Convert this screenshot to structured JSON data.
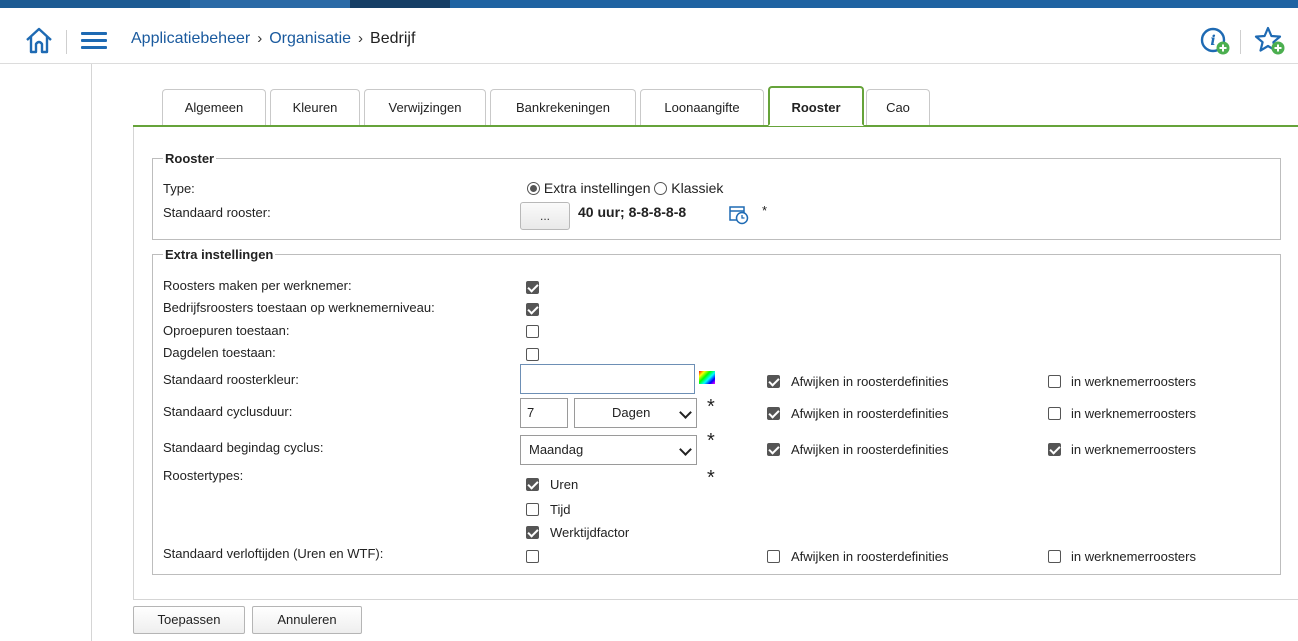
{
  "header": {
    "breadcrumb": [
      "Applicatiebeheer",
      "Organisatie",
      "Bedrijf"
    ],
    "separator": "›"
  },
  "tabs": [
    {
      "label": "Algemeen",
      "active": false
    },
    {
      "label": "Kleuren",
      "active": false
    },
    {
      "label": "Verwijzingen",
      "active": false
    },
    {
      "label": "Bankrekeningen",
      "active": false
    },
    {
      "label": "Loonaangifte",
      "active": false
    },
    {
      "label": "Rooster",
      "active": true
    },
    {
      "label": "Cao",
      "active": false
    }
  ],
  "rooster": {
    "legend": "Rooster",
    "type_label": "Type:",
    "type_options": [
      "Extra instellingen",
      "Klassiek"
    ],
    "type_selected": "Extra instellingen",
    "standaard_label": "Standaard rooster:",
    "picker_label": "...",
    "standaard_value": "40 uur; 8-8-8-8-8",
    "required_marker": "*"
  },
  "extra": {
    "legend": "Extra instellingen",
    "per_werknemer_label": "Roosters maken per werknemer:",
    "per_werknemer": true,
    "bedrijfsroosters_label": "Bedrijfsroosters toestaan op werknemerniveau:",
    "bedrijfsroosters": true,
    "oproepuren_label": "Oproepuren toestaan:",
    "oproepuren": false,
    "dagdelen_label": "Dagdelen toestaan:",
    "dagdelen": false,
    "kleur_label": "Standaard roosterkleur:",
    "kleur_value": "",
    "cyclusduur_label": "Standaard cyclusduur:",
    "cyclusduur_value": "7",
    "cyclusduur_unit": "Dagen",
    "begindag_label": "Standaard begindag cyclus:",
    "begindag_value": "Maandag",
    "roostertypes_label": "Roostertypes:",
    "roostertypes": [
      {
        "label": "Uren",
        "checked": true
      },
      {
        "label": "Tijd",
        "checked": false
      },
      {
        "label": "Werktijdfactor",
        "checked": true
      }
    ],
    "verloftijden_label": "Standaard verloftijden (Uren en WTF):",
    "verloftijden": false,
    "star": "*",
    "afwijken_label": "Afwijken in roosterdefinities",
    "werknemer_label": "in werknemerroosters",
    "overrides": [
      {
        "row": "kleur",
        "afwijken": true,
        "werknemer": false
      },
      {
        "row": "cyclusduur",
        "afwijken": true,
        "werknemer": false
      },
      {
        "row": "begindag",
        "afwijken": true,
        "werknemer": true
      },
      {
        "row": "verloftijden",
        "afwijken": false,
        "werknemer": false
      }
    ]
  },
  "buttons": {
    "apply": "Toepassen",
    "cancel": "Annuleren"
  },
  "colors": {
    "brand_blue": "#1d5b93",
    "link_blue": "#1a5a9e",
    "active_tab_green": "#66a33a",
    "badge_green": "#4caf50"
  }
}
